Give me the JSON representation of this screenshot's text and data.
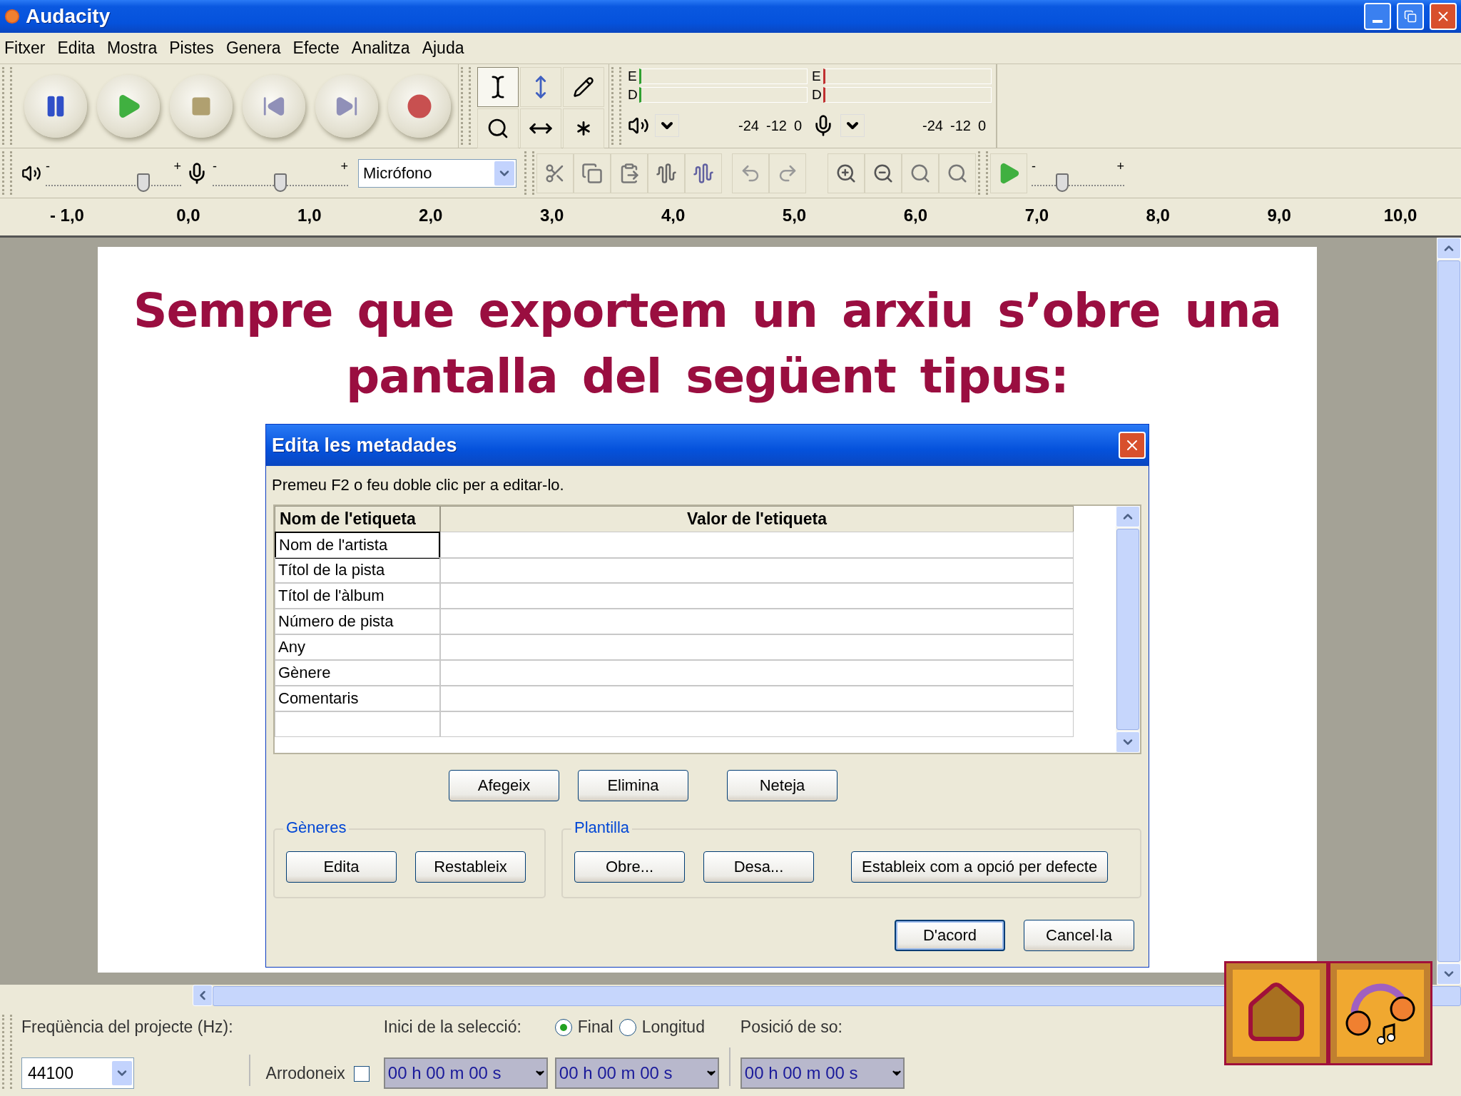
{
  "window": {
    "title": "Audacity"
  },
  "menu": [
    "Fitxer",
    "Edita",
    "Mostra",
    "Pistes",
    "Genera",
    "Efecte",
    "Analitza",
    "Ajuda"
  ],
  "tools": [
    {
      "kind": "select",
      "selected": true
    },
    {
      "kind": "envelope",
      "selected": false
    },
    {
      "kind": "draw",
      "selected": false
    },
    {
      "kind": "zoom",
      "selected": false
    },
    {
      "kind": "timeshift",
      "selected": false
    },
    {
      "kind": "multi",
      "selected": false
    }
  ],
  "meters": [
    {
      "kind": "playback",
      "channels": [
        "E",
        "D"
      ],
      "scale": [
        "-24",
        "-12",
        "0"
      ]
    },
    {
      "kind": "record",
      "channels": [
        "E",
        "D"
      ],
      "scale": [
        "-24",
        "-12",
        "0"
      ]
    }
  ],
  "mixer": {
    "output": {
      "min_label": "-",
      "max_label": "+",
      "level": 0.72
    },
    "input": {
      "min_label": "-",
      "max_label": "+",
      "level": 0.5
    },
    "input_source": "Micrófono"
  },
  "play_at_speed": {
    "min_label": "-",
    "max_label": "+",
    "level": 0.33
  },
  "ruler": [
    "- 1,0",
    "0,0",
    "1,0",
    "2,0",
    "3,0",
    "4,0",
    "5,0",
    "6,0",
    "7,0",
    "8,0",
    "9,0",
    "10,0"
  ],
  "slide": {
    "heading": "Sempre que exportem un arxiu s’obre una pantalla del següent tipus:"
  },
  "dialog": {
    "title": "Edita les metadades",
    "instruction": "Premeu F2 o feu doble clic per a editar-lo.",
    "table": {
      "columns": [
        "Nom de l'etiqueta",
        "Valor de l'etiqueta"
      ],
      "rows": [
        {
          "name": "Nom de l'artista",
          "selected": true
        },
        {
          "name": "Títol de la pista",
          "selected": false
        },
        {
          "name": "Títol de l'àlbum",
          "selected": false
        },
        {
          "name": "Número de pista",
          "selected": false
        },
        {
          "name": "Any",
          "selected": false
        },
        {
          "name": "Gènere",
          "selected": false
        },
        {
          "name": "Comentaris",
          "selected": false
        }
      ]
    },
    "buttons": [
      "Afegeix",
      "Elimina",
      "Neteja"
    ],
    "groups": [
      {
        "title": "Gèneres",
        "buttons": [
          "Edita",
          "Restableix"
        ]
      },
      {
        "title": "Plantilla",
        "buttons": [
          "Obre...",
          "Desa...",
          "Estableix com a opció per defecte"
        ]
      }
    ],
    "footer_buttons": [
      {
        "label": "D'acord",
        "default": true
      },
      {
        "label": "Cancel·la",
        "default": false
      }
    ]
  },
  "status_bar": {
    "rate_label": "Freqüència del projecte (Hz):",
    "rate": "44100",
    "snap_label": "Arrodoneix",
    "snap_checked": false,
    "selection_label": "Inici de la selecció:",
    "end_options": [
      {
        "label": "Final",
        "selected": true
      },
      {
        "label": "Longitud",
        "selected": false
      }
    ],
    "position_label": "Posició de so:",
    "times": [
      "00 h 00 m 00 s",
      "00 h 00 m 00 s",
      "00 h 00 m 00 s"
    ]
  }
}
